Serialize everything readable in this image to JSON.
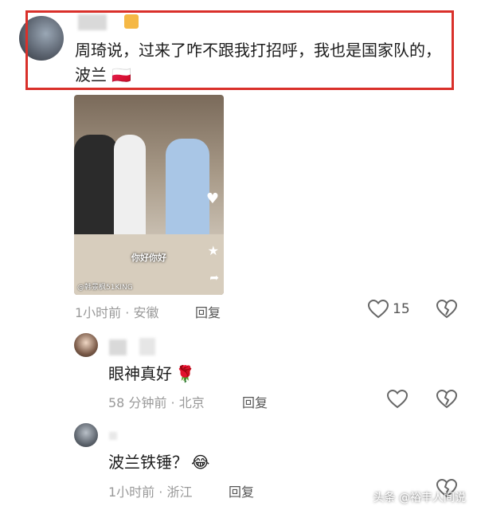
{
  "comment1": {
    "text": "周琦说，过来了咋不跟我打招呼，我也是国家队的，波兰",
    "flag_emoji": "🇵🇱",
    "video_caption": "你好你好",
    "video_credit": "@韩景枫51KING",
    "meta": "1小时前 · 安徽",
    "reply_label": "回复",
    "like_count": "15"
  },
  "reply1": {
    "text": "眼神真好",
    "emoji": "🌹",
    "meta": "58 分钟前 · 北京",
    "reply_label": "回复"
  },
  "reply2": {
    "text": "波兰铁锤？",
    "emoji": "😂",
    "meta": "1小时前 · 浙江",
    "reply_label": "回复"
  },
  "watermark": "头条 @裕丰人间说",
  "colors": {
    "highlight_border": "#d9302a",
    "meta_gray": "#999999",
    "icon_gray": "#666666"
  }
}
